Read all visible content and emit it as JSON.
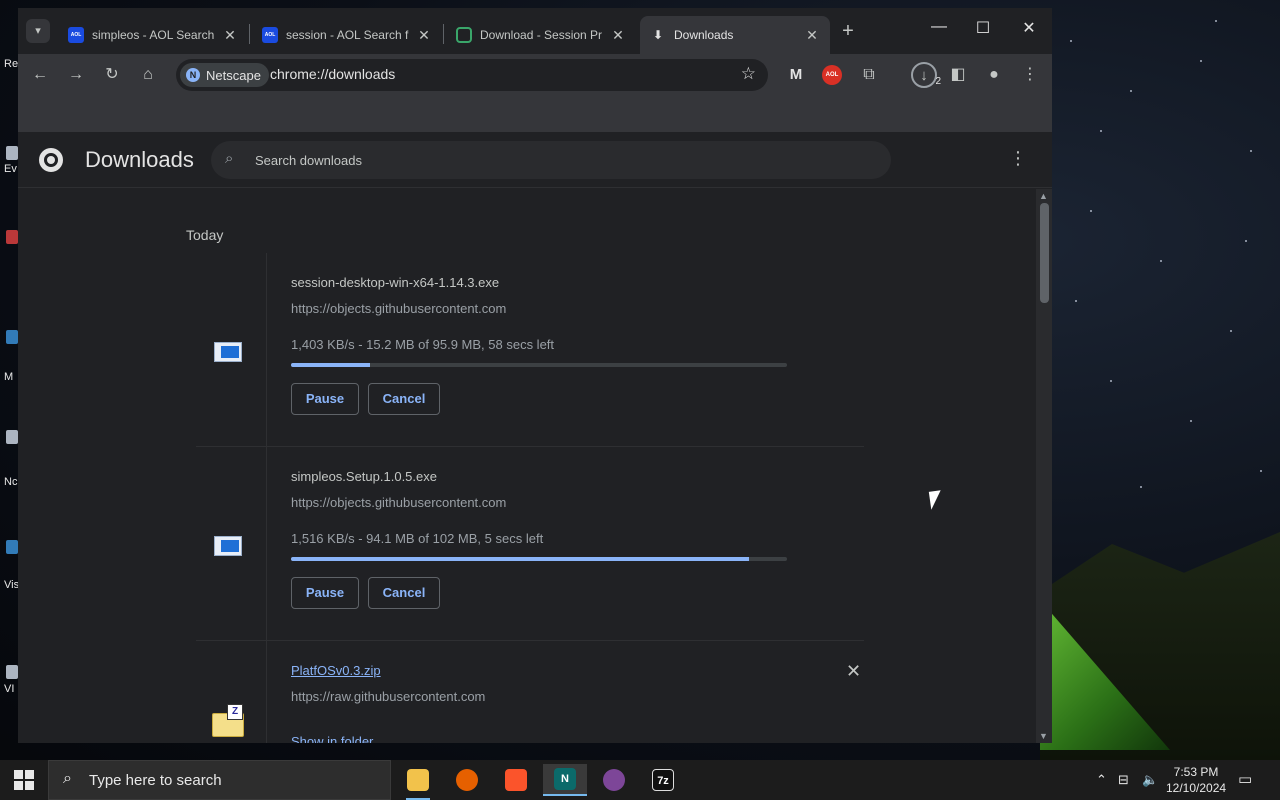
{
  "tabs": [
    {
      "label": "simpleos - AOL Search",
      "icon": "aol-icon",
      "favtext": "AOL"
    },
    {
      "label": "session - AOL Search f",
      "icon": "aol-icon",
      "favtext": "AOL"
    },
    {
      "label": "Download - Session Pr",
      "icon": "session-icon",
      "favtext": ""
    },
    {
      "label": "Downloads",
      "icon": "download-icon",
      "favtext": "⬇"
    }
  ],
  "toolbar": {
    "chip_label": "Netscape",
    "url": "chrome://downloads",
    "downloads_badge_count": "2",
    "aol_ext_text": "AOL",
    "malwarebytes_text": "M"
  },
  "page": {
    "title": "Downloads",
    "search_placeholder": "Search downloads",
    "date_heading": "Today"
  },
  "downloads": [
    {
      "filename": "session-desktop-win-x64-1.14.3.exe",
      "source": "https://objects.githubusercontent.com",
      "status": "1,403 KB/s - 15.2 MB of 95.9 MB, 58 secs left",
      "progress_percent": 15.9,
      "pause_label": "Pause",
      "cancel_label": "Cancel",
      "icon": "exe-file-icon"
    },
    {
      "filename": "simpleos.Setup.1.0.5.exe",
      "source": "https://objects.githubusercontent.com",
      "status": "1,516 KB/s - 94.1 MB of 102 MB, 5 secs left",
      "progress_percent": 92.3,
      "pause_label": "Pause",
      "cancel_label": "Cancel",
      "icon": "exe-file-icon"
    },
    {
      "filename": "PlatfOSv0.3.zip",
      "source": "https://raw.githubusercontent.com",
      "show_in_folder": "Show in folder",
      "zip_badge": "Z",
      "icon": "zip-file-icon"
    }
  ],
  "taskbar": {
    "search_placeholder": "Type here to search",
    "time": "7:53 PM",
    "date": "12/10/2024",
    "apps": [
      "file-explorer-icon",
      "firefox-icon",
      "brave-icon",
      "netscape-icon",
      "tor-browser-icon",
      "7zip-icon"
    ],
    "app_glyphs": [
      "",
      "",
      "",
      "N",
      "",
      "7z"
    ]
  },
  "desktop_labels": [
    "Re",
    "Ev",
    "M",
    "Nc",
    "Vis",
    "VI"
  ]
}
